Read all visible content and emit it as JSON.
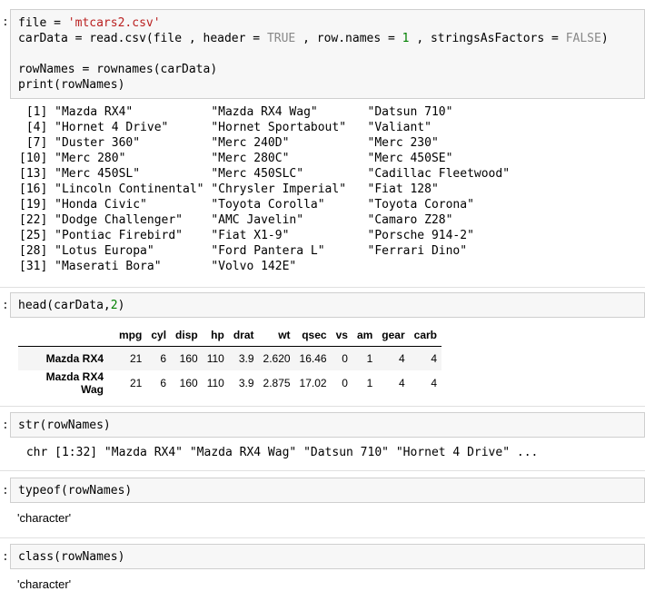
{
  "cell1": {
    "prompt": ":",
    "code": {
      "l1_a": "file",
      "l1_b": " = ",
      "l1_str": "'mtcars2.csv'",
      "l2_a": "carData",
      "l2_b": " = read.csv(file , header = ",
      "l2_true": "TRUE",
      "l2_c": " , row.names = ",
      "l2_one": "1",
      "l2_d": " , stringsAsFactors = ",
      "l2_false": "FALSE",
      "l2_e": ")",
      "l4": "rowNames = rownames(carData)",
      "l5": "print(rowNames)"
    },
    "output": " [1] \"Mazda RX4\"           \"Mazda RX4 Wag\"       \"Datsun 710\"\n [4] \"Hornet 4 Drive\"      \"Hornet Sportabout\"   \"Valiant\"\n [7] \"Duster 360\"          \"Merc 240D\"           \"Merc 230\"\n[10] \"Merc 280\"            \"Merc 280C\"           \"Merc 450SE\"\n[13] \"Merc 450SL\"          \"Merc 450SLC\"         \"Cadillac Fleetwood\"\n[16] \"Lincoln Continental\" \"Chrysler Imperial\"   \"Fiat 128\"\n[19] \"Honda Civic\"         \"Toyota Corolla\"      \"Toyota Corona\"\n[22] \"Dodge Challenger\"    \"AMC Javelin\"         \"Camaro Z28\"\n[25] \"Pontiac Firebird\"    \"Fiat X1-9\"           \"Porsche 914-2\"\n[28] \"Lotus Europa\"        \"Ford Pantera L\"      \"Ferrari Dino\"\n[31] \"Maserati Bora\"       \"Volvo 142E\""
  },
  "cell2": {
    "prompt": ":",
    "code_a": "head(carData,",
    "code_num": "2",
    "code_b": ")",
    "table": {
      "columns": [
        "mpg",
        "cyl",
        "disp",
        "hp",
        "drat",
        "wt",
        "qsec",
        "vs",
        "am",
        "gear",
        "carb"
      ],
      "rows": [
        {
          "name": "Mazda RX4",
          "values": [
            "21",
            "6",
            "160",
            "110",
            "3.9",
            "2.620",
            "16.46",
            "0",
            "1",
            "4",
            "4"
          ]
        },
        {
          "name": "Mazda RX4 Wag",
          "values": [
            "21",
            "6",
            "160",
            "110",
            "3.9",
            "2.875",
            "17.02",
            "0",
            "1",
            "4",
            "4"
          ]
        }
      ]
    }
  },
  "cell3": {
    "prompt": ":",
    "code": "str(rowNames)",
    "output": " chr [1:32] \"Mazda RX4\" \"Mazda RX4 Wag\" \"Datsun 710\" \"Hornet 4 Drive\" ..."
  },
  "cell4": {
    "prompt": ":",
    "code": "typeof(rowNames)",
    "output": "'character'"
  },
  "cell5": {
    "prompt": ":",
    "code": "class(rowNames)",
    "output": "'character'"
  }
}
